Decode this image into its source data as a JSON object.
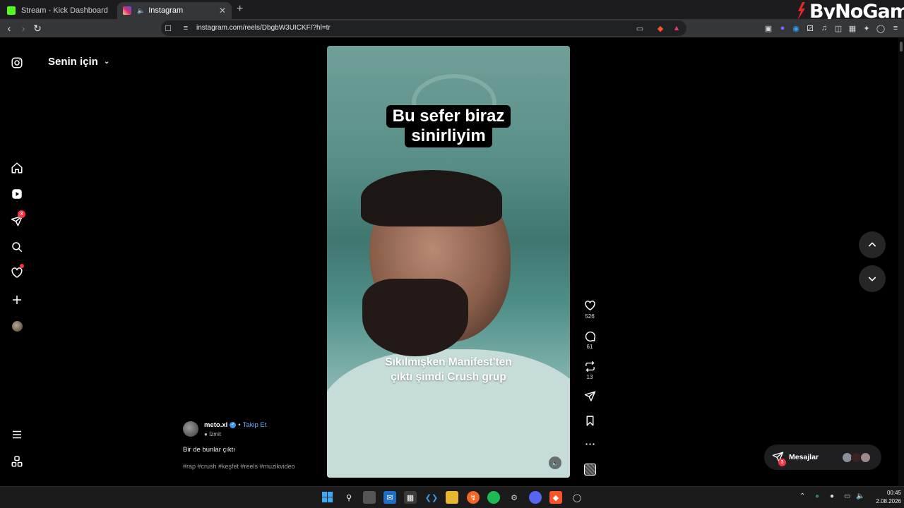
{
  "browser": {
    "tabs": [
      {
        "title": "Stream - Kick Dashboard",
        "active": false,
        "favicon_color": "#53fc18"
      },
      {
        "title": "Instagram",
        "active": true,
        "favicon_color": "#e1306c"
      }
    ],
    "url": "instagram.com/reels/DbgbW3UICKF/?hl=tr",
    "brand_watermark": "ByNoGame"
  },
  "sidebar": {
    "feed_title": "Senin için",
    "notifications_badge": "3"
  },
  "reel": {
    "caption_lines": [
      "Bu sefer biraz",
      "sinirliyim"
    ],
    "sub_caption_lines": [
      "Sıkılmışken Manifest'ten",
      "çıktı şimdi Crush grup"
    ],
    "actions": {
      "likes": "526",
      "comments": "61",
      "reposts": "13"
    },
    "author": {
      "username": "meto.xl",
      "follow_label": "Takip Et",
      "location": "İzmit",
      "separator": "•"
    },
    "description": "Bir de bunlar çıktı",
    "hashtags": "#rap #crush #keşfet #reels #muzikvideo"
  },
  "messages": {
    "label": "Mesajlar",
    "badge": "3"
  },
  "taskbar": {
    "time": "00:45",
    "date": "2.08.2026"
  },
  "colors": {
    "accent_red": "#ff3040",
    "link_blue": "#6ea8ff",
    "verified_blue": "#3897f0"
  }
}
